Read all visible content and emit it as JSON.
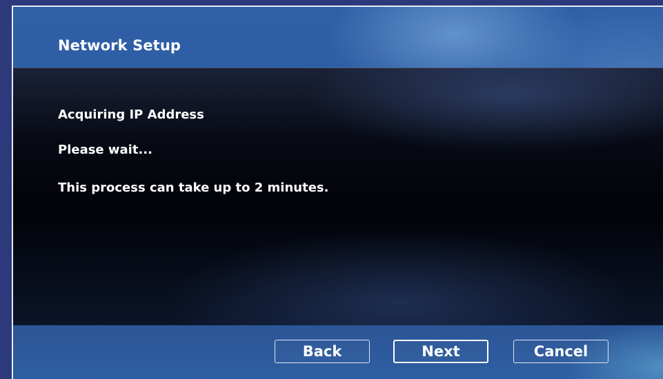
{
  "dialog": {
    "title": "Network Setup"
  },
  "content": {
    "heading": "Acquiring IP Address",
    "status": "Please wait...",
    "note": "This process can take up to 2 minutes."
  },
  "buttons": {
    "back": "Back",
    "next": "Next",
    "cancel": "Cancel"
  },
  "colors": {
    "background_blue": "#2c3a7c",
    "panel_dark": "#020308",
    "text": "#ffffff"
  }
}
